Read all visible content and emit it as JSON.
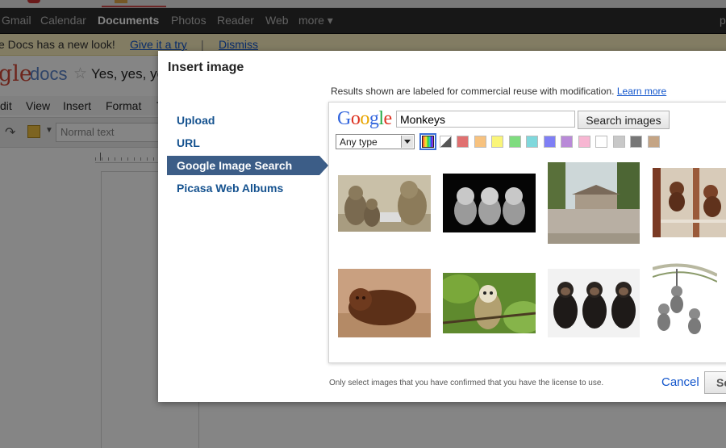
{
  "gbar": {
    "items": [
      "Gmail",
      "Calendar",
      "Documents",
      "Photos",
      "Reader",
      "Web",
      "more ▾"
    ],
    "active": "Documents",
    "right_text": "p"
  },
  "notice": {
    "text": "e Docs has a new look!",
    "try_link": "Give it a try",
    "separator": "|",
    "dismiss_link": "Dismiss"
  },
  "docs_header": {
    "logo_g": "gle",
    "logo_docs": "docs",
    "star": "☆",
    "doc_title": "Yes, yes, yes"
  },
  "menubar": {
    "items": [
      "dit",
      "View",
      "Insert",
      "Format",
      "T"
    ]
  },
  "toolbar": {
    "style_value": "Normal text",
    "redo_icon": "↷",
    "caret": "▼"
  },
  "dialog": {
    "title": "Insert image",
    "nav": [
      {
        "label": "Upload",
        "active": false
      },
      {
        "label": "URL",
        "active": false
      },
      {
        "label": "Google Image Search",
        "active": true
      },
      {
        "label": "Picasa Web Albums",
        "active": false
      }
    ],
    "results_note": "Results shown are labeled for commercial reuse with modification.",
    "learn_more": "Learn more",
    "search": {
      "logo": "Google",
      "query": "Monkeys",
      "button": "Search images",
      "type_filter": "Any type"
    },
    "color_swatches": [
      {
        "name": "all-colors",
        "color": "multicolor",
        "selected": true
      },
      {
        "name": "black-and-white",
        "color": "grayscale"
      },
      {
        "name": "red",
        "color": "#e07070"
      },
      {
        "name": "orange",
        "color": "#f7c27f"
      },
      {
        "name": "yellow",
        "color": "#faf579"
      },
      {
        "name": "green",
        "color": "#7fdc7f"
      },
      {
        "name": "teal",
        "color": "#7fd8dc"
      },
      {
        "name": "blue",
        "color": "#7f7ff5"
      },
      {
        "name": "purple",
        "color": "#b98ad8"
      },
      {
        "name": "pink",
        "color": "#f7b6d2"
      },
      {
        "name": "white",
        "color": "#ffffff"
      },
      {
        "name": "gray",
        "color": "#c8c8c8"
      },
      {
        "name": "black",
        "color": "#777777"
      },
      {
        "name": "brown",
        "color": "#c4a484"
      }
    ],
    "results": [
      {
        "name": "image-result-1",
        "subject": "monkeys with laptop"
      },
      {
        "name": "image-result-2",
        "subject": "three wise monkeys black and white"
      },
      {
        "name": "image-result-3",
        "subject": "zoo entrance building"
      },
      {
        "name": "image-result-4",
        "subject": "monkey figurine on shelf"
      },
      {
        "name": "image-result-5",
        "subject": "wooden monkey carving"
      },
      {
        "name": "image-result-6",
        "subject": "squirrel monkey in tree"
      },
      {
        "name": "image-result-7",
        "subject": "three chimpanzees"
      },
      {
        "name": "image-result-8",
        "subject": "cartoon monkeys hanging"
      }
    ],
    "license_note": "Only select images that you have confirmed that you have the license to use.",
    "cancel": "Cancel",
    "select": "Select"
  }
}
